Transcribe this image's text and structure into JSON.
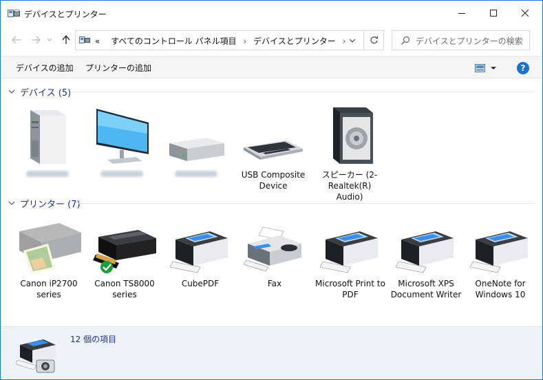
{
  "window": {
    "title": "デバイスとプリンター"
  },
  "address": {
    "overflow": "«",
    "crumbs": [
      "すべてのコントロール パネル項目",
      "デバイスとプリンター"
    ],
    "trailing": "›"
  },
  "search": {
    "placeholder": "デバイスとプリンターの検索"
  },
  "toolbar": {
    "add_device": "デバイスの追加",
    "add_printer": "プリンターの追加",
    "help": "?"
  },
  "groups": {
    "devices": {
      "title": "デバイス (5)",
      "items": [
        {
          "label": "",
          "icon": "computer-tower-icon"
        },
        {
          "label": "",
          "icon": "monitor-icon"
        },
        {
          "label": "",
          "icon": "drive-icon"
        },
        {
          "label": "USB Composite Device",
          "icon": "keyboard-icon"
        },
        {
          "label": "スピーカー (2- Realtek(R) Audio)",
          "icon": "speaker-icon"
        }
      ]
    },
    "printers": {
      "title": "プリンター (7)",
      "items": [
        {
          "label": "Canon iP2700 series",
          "icon": "printer-photo-icon"
        },
        {
          "label": "Canon TS8000 series",
          "icon": "printer-default-icon",
          "default": true
        },
        {
          "label": "CubePDF",
          "icon": "printer-icon"
        },
        {
          "label": "Fax",
          "icon": "fax-icon"
        },
        {
          "label": "Microsoft Print to PDF",
          "icon": "printer-icon"
        },
        {
          "label": "Microsoft XPS Document Writer",
          "icon": "printer-icon"
        },
        {
          "label": "OneNote for Windows 10",
          "icon": "printer-icon"
        }
      ]
    }
  },
  "status": {
    "count": "12 個の項目"
  },
  "colors": {
    "accent": "#1779d4",
    "group_title": "#1e3287",
    "details_bg": "#eef3f9",
    "default_check": "#1e9e3a"
  }
}
